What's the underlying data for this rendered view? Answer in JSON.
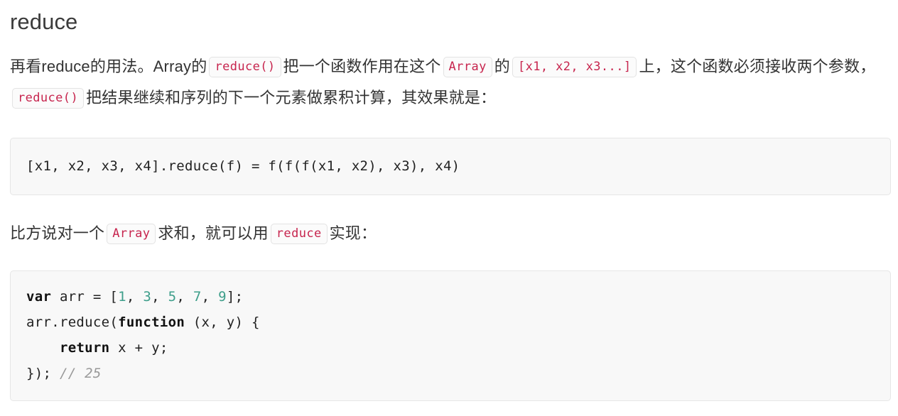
{
  "heading": "reduce",
  "paragraph_1": {
    "segments": [
      {
        "type": "text",
        "value": "再看reduce的用法。Array的"
      },
      {
        "type": "code",
        "value": "reduce()"
      },
      {
        "type": "text",
        "value": "把一个函数作用在这个"
      },
      {
        "type": "code",
        "value": "Array"
      },
      {
        "type": "text",
        "value": "的"
      },
      {
        "type": "code",
        "value": "[x1, x2, x3...]"
      },
      {
        "type": "text",
        "value": "上，这个函数必须接收两个参数，"
      },
      {
        "type": "code",
        "value": "reduce()"
      },
      {
        "type": "text",
        "value": "把结果继续和序列的下一个元素做累积计算，其效果就是："
      }
    ]
  },
  "code_block_1": {
    "language": "plain",
    "lines": [
      [
        {
          "t": "plain",
          "v": "[x1, x2, x3, x4].reduce(f) = f(f(f(x1, x2), x3), x4)"
        }
      ]
    ]
  },
  "paragraph_2": {
    "segments": [
      {
        "type": "text",
        "value": "比方说对一个"
      },
      {
        "type": "code",
        "value": "Array"
      },
      {
        "type": "text",
        "value": "求和，就可以用"
      },
      {
        "type": "code",
        "value": "reduce"
      },
      {
        "type": "text",
        "value": "实现："
      }
    ]
  },
  "code_block_2": {
    "language": "javascript",
    "lines": [
      [
        {
          "t": "kw",
          "v": "var"
        },
        {
          "t": "plain",
          "v": " arr = ["
        },
        {
          "t": "num",
          "v": "1"
        },
        {
          "t": "plain",
          "v": ", "
        },
        {
          "t": "num",
          "v": "3"
        },
        {
          "t": "plain",
          "v": ", "
        },
        {
          "t": "num",
          "v": "5"
        },
        {
          "t": "plain",
          "v": ", "
        },
        {
          "t": "num",
          "v": "7"
        },
        {
          "t": "plain",
          "v": ", "
        },
        {
          "t": "num",
          "v": "9"
        },
        {
          "t": "plain",
          "v": "];"
        }
      ],
      [
        {
          "t": "plain",
          "v": "arr.reduce("
        },
        {
          "t": "kw",
          "v": "function"
        },
        {
          "t": "plain",
          "v": " (x, y) {"
        }
      ],
      [
        {
          "t": "plain",
          "v": "    "
        },
        {
          "t": "kw",
          "v": "return"
        },
        {
          "t": "plain",
          "v": " x + y;"
        }
      ],
      [
        {
          "t": "plain",
          "v": "}); "
        },
        {
          "t": "com",
          "v": "// 25"
        }
      ]
    ]
  },
  "colors": {
    "heading": "#3b3b3b",
    "body_text": "#333333",
    "inline_code_text": "#c7254e",
    "inline_code_bg": "#fbfbfb",
    "inline_code_border": "#e3e3e3",
    "code_block_bg": "#f8f8f8",
    "code_block_border": "#e6e6e6",
    "keyword": "#111111",
    "number": "#3d9e8a",
    "comment": "#999999"
  }
}
